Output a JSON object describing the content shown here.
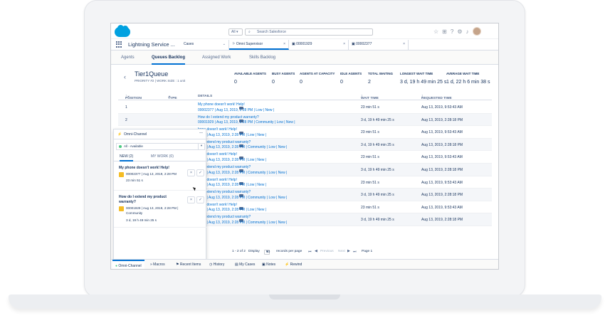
{
  "header": {
    "search_scope": "All",
    "search_placeholder": "Search Salesforce"
  },
  "app_name": "Lightning Service ...",
  "workspace_tabs": [
    {
      "label": "Cases"
    },
    {
      "label": "Omni Supervisor"
    },
    {
      "label": "00001929"
    },
    {
      "label": "00002377"
    }
  ],
  "sub_tabs": [
    "Agents",
    "Queues Backlog",
    "Assigned Work",
    "Skills Backlog"
  ],
  "queue": {
    "title": "Tier1Queue",
    "subtitle": "PRIORITY #2  |  WORK SIZE : 1 unit"
  },
  "stats": [
    {
      "label": "AVAILABLE AGENTS",
      "value": "0"
    },
    {
      "label": "BUSY AGENTS",
      "value": "0"
    },
    {
      "label": "AGENTS AT CAPACITY",
      "value": "0"
    },
    {
      "label": "IDLE AGENTS",
      "value": "0"
    },
    {
      "label": "TOTAL WAITING",
      "value": "2"
    },
    {
      "label": "LONGEST WAIT TIME",
      "value": "3 d, 19 h 49 min 25 s"
    },
    {
      "label": "AVERAGE WAIT TIME",
      "value": "1 d, 22 h 6 min 38 s"
    }
  ],
  "grid": {
    "headers": [
      "POSITION",
      "TYPE",
      "DETAILS",
      "WAIT TIME",
      "REQUESTED TIME"
    ],
    "rows": [
      {
        "pos": "1",
        "title": "My phone doesn't work! Help!",
        "meta": "00002377 | Aug 13, 2019, 2:28 PM | Low | New |",
        "wait": "23 min 51 s",
        "req": "Aug 13, 2019, 9:53:43 AM"
      },
      {
        "pos": "2",
        "title": "How do I extend my product warranty?",
        "meta": "00001929 | Aug 13, 2019, 2:28 PM | Community | Low | New |",
        "wait": "3 d, 19 h 49 min 25 s",
        "req": "Aug 13, 2019, 2:28:18 PM"
      },
      {
        "pos": "",
        "title": "hone doesn't work! Help!",
        "meta": "2377 | Aug 13, 2019, 2:28 PM | Low | New |",
        "wait": "23 min 51 s",
        "req": "Aug 13, 2019, 9:53:43 AM"
      },
      {
        "pos": "",
        "title": "do I extend my product warranty?",
        "meta": "1929 | Aug 13, 2019, 2:28 PM | Community | Low | New |",
        "wait": "3 d, 19 h 49 min 25 s",
        "req": "Aug 13, 2019, 2:28:18 PM"
      },
      {
        "pos": "",
        "title": "hone doesn't work! Help!",
        "meta": "2377 | Aug 13, 2019, 2:28 PM | Low | New |",
        "wait": "23 min 51 s",
        "req": "Aug 13, 2019, 9:53:43 AM"
      },
      {
        "pos": "",
        "title": "do I extend my product warranty?",
        "meta": "1929 | Aug 13, 2019, 2:28 PM | Community | Low | New |",
        "wait": "3 d, 19 h 49 min 25 s",
        "req": "Aug 13, 2019, 2:28:18 PM"
      },
      {
        "pos": "",
        "title": "hone doesn't work! Help!",
        "meta": "2377 | Aug 13, 2019, 2:28 PM | Low | New |",
        "wait": "23 min 51 s",
        "req": "Aug 13, 2019, 9:53:43 AM"
      },
      {
        "pos": "",
        "title": "do I extend my product warranty?",
        "meta": "1929 | Aug 13, 2019, 2:28 PM | Community | Low | New |",
        "wait": "3 d, 19 h 49 min 25 s",
        "req": "Aug 13, 2019, 2:28:18 PM"
      },
      {
        "pos": "",
        "title": "hone doesn't work! Help!",
        "meta": "2377 | Aug 13, 2019, 2:28 PM | Low | New |",
        "wait": "23 min 51 s",
        "req": "Aug 13, 2019, 9:53:43 AM"
      },
      {
        "pos": "",
        "title": "do I extend my product warranty?",
        "meta": "1929 | Aug 13, 2019, 2:28 PM | Community | Low | New |",
        "wait": "3 d, 19 h 49 min 25 s",
        "req": "Aug 13, 2019, 2:28:18 PM"
      }
    ]
  },
  "pager": {
    "range": "1 - 2 of 2",
    "display": "Display",
    "size": "10",
    "per_page": "records per page",
    "previous": "Previous",
    "next": "Next",
    "page": "Page 1"
  },
  "omni": {
    "title": "Omni-Channel",
    "status": "All - Available",
    "tab_new": "NEW (2)",
    "tab_mywork": "MY WORK (0)",
    "items": [
      {
        "title": "My phone doesn't work! Help!",
        "line1": "00002377 | Aug 13, 2019, 2:28 PM",
        "line2": "23 min 51 s"
      },
      {
        "title": "How do I extend my product warranty?",
        "line1": "00001929 | Aug 13, 2019, 2:28 PM | Community",
        "line2": "3 d, 19 h 49 min 25 s"
      }
    ]
  },
  "utility_bar": [
    "Omni-Channel",
    "Macros",
    "Recent Items",
    "History",
    "My Cases",
    "Notes",
    "Rewind"
  ]
}
